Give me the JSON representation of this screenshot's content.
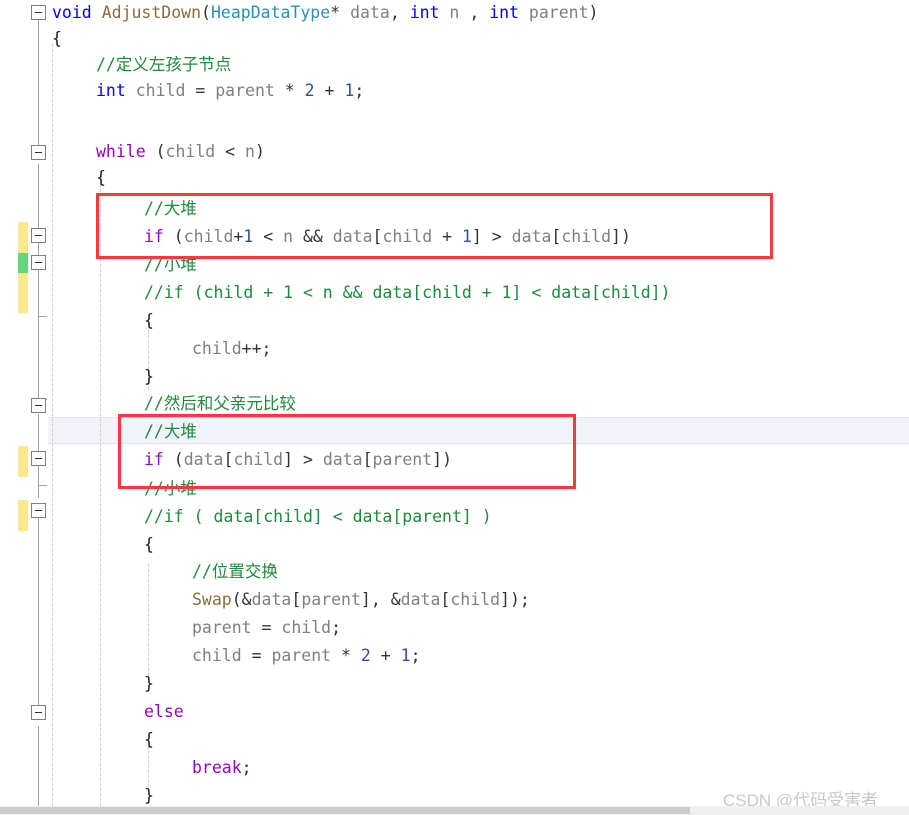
{
  "editor": {
    "language": "C",
    "background_color": "#ffffff",
    "current_line_highlight_color": "#f2f2f9",
    "annotation_box_color": "#f83a3a",
    "change_bar_unsaved_color": "#fbe98b",
    "change_bar_saved_color": "#63d67a"
  },
  "watermark": {
    "text": "CSDN @代码受害者"
  },
  "syntax_colors": {
    "keyword": "#0000ff",
    "control_keyword": "#8f08c4",
    "type": "#2b91af",
    "function": "#8a6d3b",
    "identifier": "#808080",
    "number": "#2f4f9f",
    "comment": "#1f8a3c",
    "punctuation": "#333333"
  },
  "code_lines": [
    {
      "indent": 0,
      "text": "void AdjustDown(HeapDataType* data, int n , int parent)"
    },
    {
      "indent": 0,
      "text": "{"
    },
    {
      "indent": 1,
      "text": "//定义左孩子节点"
    },
    {
      "indent": 1,
      "text": "int child = parent * 2 + 1;"
    },
    {
      "indent": 0,
      "text": ""
    },
    {
      "indent": 1,
      "text": "while (child < n)"
    },
    {
      "indent": 1,
      "text": "{"
    },
    {
      "indent": 2,
      "text": "//大堆"
    },
    {
      "indent": 2,
      "text": "if (child+1 < n && data[child + 1] > data[child])"
    },
    {
      "indent": 2,
      "text": "//小堆"
    },
    {
      "indent": 2,
      "text": "//if (child + 1 < n && data[child + 1] < data[child])"
    },
    {
      "indent": 2,
      "text": "{"
    },
    {
      "indent": 3,
      "text": "child++;"
    },
    {
      "indent": 2,
      "text": "}"
    },
    {
      "indent": 2,
      "text": "//然后和父亲元比较"
    },
    {
      "indent": 2,
      "text": "//大堆"
    },
    {
      "indent": 2,
      "text": "if (data[child] > data[parent])"
    },
    {
      "indent": 2,
      "text": "//小堆"
    },
    {
      "indent": 2,
      "text": "//if ( data[child] < data[parent] )"
    },
    {
      "indent": 2,
      "text": "{"
    },
    {
      "indent": 3,
      "text": "//位置交换"
    },
    {
      "indent": 3,
      "text": "Swap(&data[parent], &data[child]);"
    },
    {
      "indent": 3,
      "text": "parent = child;"
    },
    {
      "indent": 3,
      "text": "child = parent * 2 + 1;"
    },
    {
      "indent": 2,
      "text": "}"
    },
    {
      "indent": 2,
      "text": "else"
    },
    {
      "indent": 2,
      "text": "{"
    },
    {
      "indent": 3,
      "text": "break;"
    },
    {
      "indent": 2,
      "text": "}"
    }
  ],
  "annotations": [
    {
      "name": "max-heap-child-compare-box",
      "lines": "//大堆 + if (child+1 < n && data[child + 1] > data[child])"
    },
    {
      "name": "max-heap-parent-compare-box",
      "lines": "//大堆 + if (data[child] > data[parent])"
    }
  ],
  "gutter": {
    "fold_markers_count": 8,
    "change_bars": [
      {
        "state": "unsaved",
        "color": "#fbe98b"
      },
      {
        "state": "saved",
        "color": "#63d67a"
      },
      {
        "state": "unsaved",
        "color": "#fbe98b"
      },
      {
        "state": "unsaved",
        "color": "#fbe98b"
      },
      {
        "state": "unsaved",
        "color": "#fbe98b"
      }
    ]
  }
}
